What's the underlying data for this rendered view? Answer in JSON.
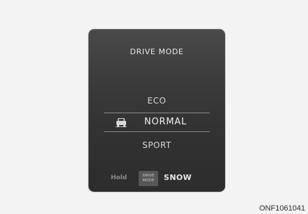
{
  "panel": {
    "title": "DRIVE MODE",
    "modes": {
      "eco": "ECO",
      "normal": "NORMAL",
      "sport": "SPORT"
    },
    "selected_icon": "car-icon",
    "hold": {
      "label": "Hold",
      "button_line1": "DRIVE",
      "button_line2": "MODE",
      "target": "SNOW"
    }
  },
  "figure_code": "ONF1061041",
  "colors": {
    "background": "#f3f3f3",
    "panel": "#3a3a3a",
    "text": "#e8e8e8"
  }
}
